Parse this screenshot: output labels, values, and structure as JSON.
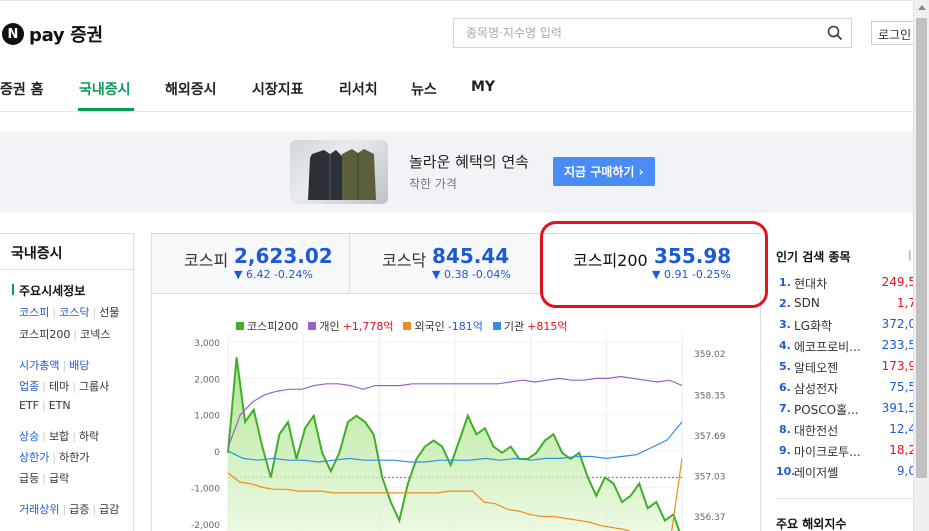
{
  "header": {
    "logo_letter": "N",
    "brand": "pay 증권",
    "search_placeholder": "종목명·지수명 입력",
    "login_label": "로그인"
  },
  "nav": {
    "tabs": [
      {
        "label": "증권 홈",
        "active": false
      },
      {
        "label": "국내증시",
        "active": true
      },
      {
        "label": "해외증시",
        "active": false
      },
      {
        "label": "시장지표",
        "active": false
      },
      {
        "label": "리서치",
        "active": false
      },
      {
        "label": "뉴스",
        "active": false
      },
      {
        "label": "MY",
        "active": false
      }
    ]
  },
  "banner": {
    "title": "놀라운 혜택의 연속",
    "subtitle": "착한 가격",
    "cta_label": "지금 구매하기 ›"
  },
  "sidebar": {
    "title": "국내증시",
    "section_head": "주요시세정보",
    "rows": [
      [
        "코스피",
        "코스닥",
        "선물"
      ],
      [
        "코스피200",
        "코넥스"
      ],
      [
        "시가총액",
        "배당"
      ],
      [
        "업종",
        "테마",
        "그룹사"
      ],
      [
        "ETF",
        "ETN"
      ],
      [
        "상승",
        "보합",
        "하락"
      ],
      [
        "상한가",
        "하한가"
      ],
      [
        "급등",
        "급락"
      ],
      [
        "거래상위",
        "급증",
        "급감"
      ]
    ]
  },
  "indices": [
    {
      "name": "코스피",
      "value": "2,623.02",
      "change": "▼ 6.42 -0.24%"
    },
    {
      "name": "코스닥",
      "value": "845.44",
      "change": "▼ 0.38 -0.04%"
    },
    {
      "name": "코스피200",
      "value": "355.98",
      "change": "▼ 0.91 -0.25%"
    }
  ],
  "chart_legend": [
    {
      "label": "코스피200",
      "value": "",
      "color": "#3fae29"
    },
    {
      "label": "개인",
      "value": "+1,778억",
      "color": "#9a62c8"
    },
    {
      "label": "외국인",
      "value": "-181억",
      "color": "#f08c1f"
    },
    {
      "label": "기관",
      "value": "+815억",
      "color": "#2f8fe0"
    }
  ],
  "chart_data": {
    "type": "line",
    "title": "",
    "left_axis": {
      "ticks": [
        "3,000",
        "2,000",
        "1,000",
        "0",
        "-1,000",
        "-2,000"
      ],
      "ylim": [
        -2500,
        3000
      ]
    },
    "right_axis": {
      "ticks": [
        "359.02",
        "358.35",
        "357.69",
        "357.03",
        "356.37"
      ],
      "ylim": [
        355.95,
        359.2
      ]
    },
    "reference_line": 357.0,
    "series": [
      {
        "name": "코스피200",
        "axis": "right",
        "color": "#3fae29",
        "values": [
          357.4,
          358.95,
          357.9,
          358.1,
          357.5,
          357.0,
          357.7,
          357.9,
          357.3,
          357.8,
          358.0,
          357.4,
          357.1,
          357.4,
          357.9,
          358.0,
          357.9,
          357.7,
          357.0,
          356.6,
          356.3,
          356.9,
          357.3,
          357.5,
          357.6,
          357.5,
          357.2,
          357.6,
          358.0,
          357.7,
          357.8,
          357.5,
          357.4,
          357.5,
          357.3,
          357.3,
          357.4,
          357.6,
          357.7,
          357.4,
          357.3,
          357.4,
          357.0,
          356.7,
          357.0,
          356.9,
          356.6,
          356.7,
          356.9,
          356.5,
          356.6,
          356.3,
          356.4,
          356.0
        ]
      },
      {
        "name": "개인",
        "axis": "left",
        "color": "#9a62c8",
        "values": [
          100,
          1000,
          1350,
          1550,
          1650,
          1700,
          1700,
          1800,
          1850,
          1850,
          1800,
          1700,
          1800,
          1800,
          1800,
          1850,
          1850,
          1850,
          1850,
          1850,
          1850,
          1850,
          1850,
          1900,
          1950,
          1900,
          1950,
          2000,
          1950,
          1950,
          2000,
          2000,
          2050,
          2000,
          1950,
          1900,
          1950,
          1800
        ]
      },
      {
        "name": "외국인",
        "axis": "left",
        "color": "#f08c1f",
        "values": [
          -600,
          -850,
          -900,
          -1000,
          -1050,
          -1050,
          -1100,
          -1100,
          -1100,
          -1150,
          -1150,
          -1150,
          -1150,
          -1150,
          -1150,
          -1150,
          -1150,
          -1150,
          -1150,
          -1100,
          -1100,
          -1100,
          -1400,
          -1450,
          -1600,
          -1650,
          -1750,
          -1800,
          -1800,
          -1850,
          -1900,
          -1950,
          -2050,
          -2100,
          -2150,
          -2250,
          -2400,
          -2450,
          -2450,
          -200
        ]
      },
      {
        "name": "기관",
        "axis": "left",
        "color": "#2f8fe0",
        "values": [
          0,
          -200,
          -250,
          -200,
          -250,
          -250,
          -300,
          -250,
          -200,
          -250,
          -250,
          -250,
          -300,
          -300,
          -250,
          -250,
          -250,
          -200,
          -250,
          -200,
          -250,
          -200,
          -200,
          -150,
          -150,
          -200,
          -150,
          -100,
          100,
          300,
          800
        ]
      }
    ]
  },
  "popular": {
    "title": "인기 검색 종목",
    "mark": "|",
    "items": [
      {
        "rank": "1.",
        "name": "현대차",
        "price": "249,5",
        "dir": "up"
      },
      {
        "rank": "2.",
        "name": "SDN",
        "price": "1,7",
        "dir": "up"
      },
      {
        "rank": "3.",
        "name": "LG화학",
        "price": "372,0",
        "dir": "dn"
      },
      {
        "rank": "4.",
        "name": "에코프로비...",
        "price": "233,5",
        "dir": "dn"
      },
      {
        "rank": "5.",
        "name": "알테오젠",
        "price": "173,9",
        "dir": "up"
      },
      {
        "rank": "6.",
        "name": "삼성전자",
        "price": "75,5",
        "dir": "dn"
      },
      {
        "rank": "7.",
        "name": "POSCO홀...",
        "price": "391,5",
        "dir": "dn"
      },
      {
        "rank": "8.",
        "name": "대한전선",
        "price": "12,4",
        "dir": "dn"
      },
      {
        "rank": "9.",
        "name": "마이크로투...",
        "price": "18,2",
        "dir": "up"
      },
      {
        "rank": "10.",
        "name": "레이저쎌",
        "price": "9,0",
        "dir": "dn"
      }
    ],
    "next_title": "주요 해외지수"
  }
}
